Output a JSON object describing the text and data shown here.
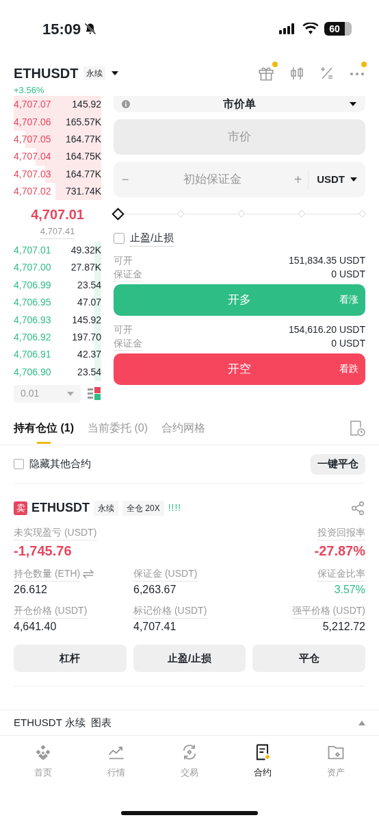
{
  "status_bar": {
    "time": "15:09",
    "battery": "60"
  },
  "header": {
    "symbol": "ETHUSDT",
    "tag": "永续",
    "change": "+3.56%"
  },
  "order_book": {
    "asks": [
      {
        "price": "4,707.07",
        "amount": "145.92"
      },
      {
        "price": "4,707.06",
        "amount": "165.57K"
      },
      {
        "price": "4,707.05",
        "amount": "164.77K"
      },
      {
        "price": "4,707.04",
        "amount": "164.75K"
      },
      {
        "price": "4,707.03",
        "amount": "164.77K"
      },
      {
        "price": "4,707.02",
        "amount": "731.74K"
      }
    ],
    "last_price": "4,707.01",
    "mark_price": "4,707.41",
    "bids": [
      {
        "price": "4,707.01",
        "amount": "49.32K"
      },
      {
        "price": "4,707.00",
        "amount": "27.87K"
      },
      {
        "price": "4,706.99",
        "amount": "23.54"
      },
      {
        "price": "4,706.95",
        "amount": "47.07"
      },
      {
        "price": "4,706.93",
        "amount": "145.92"
      },
      {
        "price": "4,706.92",
        "amount": "197.70"
      },
      {
        "price": "4,706.91",
        "amount": "42.37"
      },
      {
        "price": "4,706.90",
        "amount": "23.54"
      }
    ],
    "precision": "0.01"
  },
  "order_form": {
    "order_type": "市价单",
    "price_field": "市价",
    "margin_placeholder": "初始保证金",
    "minus": "−",
    "plus": "+",
    "currency": "USDT",
    "tpsl": {
      "label": "止盈/止损",
      "checked": false
    },
    "long": {
      "available_label": "可开",
      "available": "151,834.35 USDT",
      "margin_label": "保证金",
      "margin": "0 USDT",
      "button": "开多",
      "hint": "看涨"
    },
    "short": {
      "available_label": "可开",
      "available": "154,616.20 USDT",
      "margin_label": "保证金",
      "margin": "0 USDT",
      "button": "开空",
      "hint": "看跌"
    }
  },
  "tabs": [
    {
      "label": "持有仓位 (1)",
      "selected": true
    },
    {
      "label": "当前委托 (0)",
      "selected": false
    },
    {
      "label": "合约网格",
      "selected": false
    }
  ],
  "hide_others": {
    "label": "隐藏其他合约",
    "checked": false
  },
  "close_all": "一键平仓",
  "position": {
    "side": "卖",
    "symbol": "ETHUSDT",
    "tags": [
      "永续",
      "全仓 20X"
    ],
    "risk": "!!!!",
    "pnl_label": "未实现盈亏 (USDT)",
    "pnl": "-1,745.76",
    "roe_label": "投资回报率",
    "roe": "-27.87%",
    "fields": [
      {
        "label": "持仓数量 (ETH)",
        "value": "26.612"
      },
      {
        "label": "保证金 (USDT)",
        "value": "6,263.67"
      },
      {
        "label": "保证金比率",
        "value": "3.57%",
        "positive": true
      },
      {
        "label": "开仓价格 (USDT)",
        "value": "4,641.40"
      },
      {
        "label": "标记价格 (USDT)",
        "value": "4,707.41"
      },
      {
        "label": "强平价格 (USDT)",
        "value": "5,212.72"
      }
    ],
    "buttons": [
      "杠杆",
      "止盈/止损",
      "平仓"
    ]
  },
  "chart_bar": {
    "label": "ETHUSDT 永续  图表"
  },
  "bottom_nav": [
    {
      "label": "首页",
      "selected": false
    },
    {
      "label": "行情",
      "selected": false
    },
    {
      "label": "交易",
      "selected": false
    },
    {
      "label": "合约",
      "selected": true
    },
    {
      "label": "资产",
      "selected": false
    }
  ]
}
